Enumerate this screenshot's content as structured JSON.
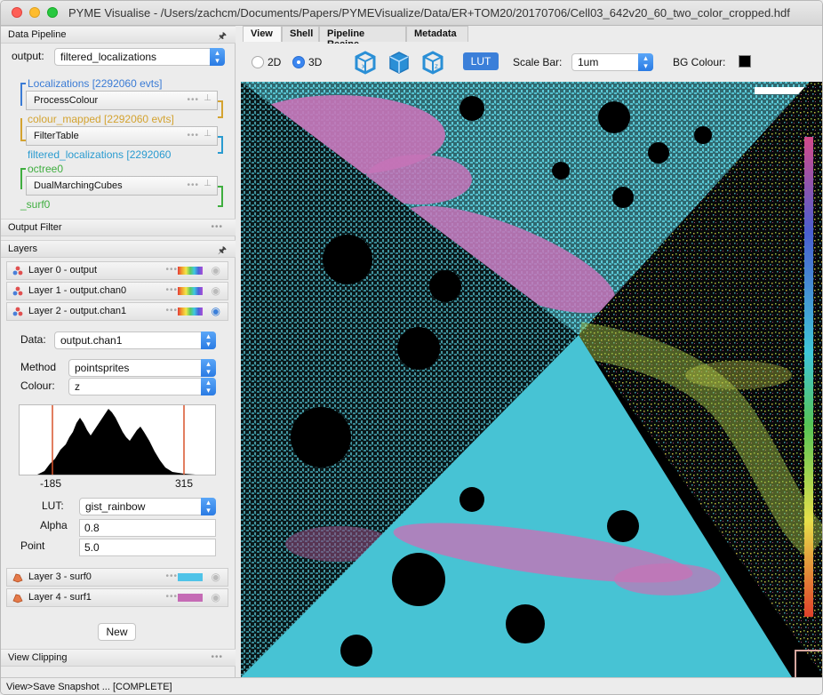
{
  "window": {
    "title": "PYME Visualise - /Users/zachcm/Documents/Papers/PYMEVisualize/Data/ER+TOM20/20170706/Cell03_642v20_60_two_color_cropped.hdf"
  },
  "pipeline": {
    "header": "Data Pipeline",
    "output_label": "output:",
    "output_value": "filtered_localizations",
    "items": [
      {
        "text": "Localizations [2292060 evts]",
        "color": "#3a7bd5"
      },
      {
        "module": "ProcessColour"
      },
      {
        "text": "colour_mapped [2292060 evts]",
        "color": "#d4a330"
      },
      {
        "module": "FilterTable"
      },
      {
        "text": "filtered_localizations [2292060",
        "color": "#2a9bd0"
      },
      {
        "text": "octree0",
        "color": "#3fae3f"
      },
      {
        "module": "DualMarchingCubes"
      },
      {
        "text": "_surf0",
        "color": "#3fae3f"
      }
    ]
  },
  "output_filter": {
    "header": "Output Filter"
  },
  "layers": {
    "header": "Layers",
    "rows": [
      {
        "label": "Layer 0 - output"
      },
      {
        "label": "Layer 1 - output.chan0"
      },
      {
        "label": "Layer 2 - output.chan1"
      },
      {
        "label": "Layer 3 - surf0",
        "color": "#4fc3e8"
      },
      {
        "label": "Layer 4 - surf1",
        "color": "#c56bb5"
      }
    ],
    "detail": {
      "data_label": "Data:",
      "data_value": "output.chan1",
      "method_label": "Method",
      "method_value": "pointsprites",
      "colour_label": "Colour:",
      "colour_value": "z",
      "hist_min": "-185",
      "hist_max": "315",
      "lut_label": "LUT:",
      "lut_value": "gist_rainbow",
      "alpha_label": "Alpha",
      "alpha_value": "0.8",
      "point_label": "Point",
      "point_value": "5.0"
    },
    "new_button": "New"
  },
  "view_clipping": {
    "header": "View Clipping"
  },
  "tabs": [
    "View",
    "Shell",
    "Pipeline Recipe",
    "Metadata"
  ],
  "toolbar": {
    "mode_2d": "2D",
    "mode_3d": "3D",
    "lut_button": "LUT",
    "scalebar_label": "Scale Bar:",
    "scalebar_value": "1um",
    "bg_label": "BG Colour:",
    "bg_color": "#000000"
  },
  "status": "View>Save Snapshot ... [COMPLETE]"
}
